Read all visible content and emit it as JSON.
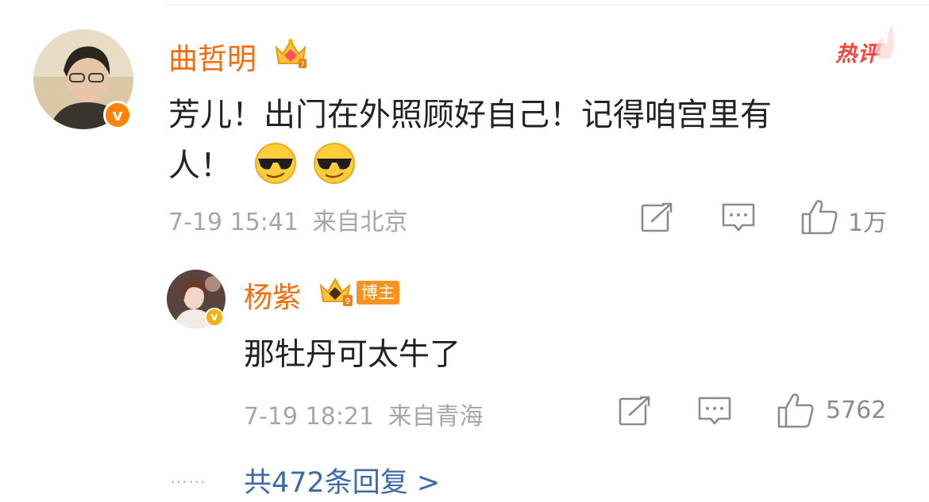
{
  "comment": {
    "username": "曲哲明",
    "badge": "热评",
    "content_line1": "芳儿！出门在外照顾好自己！记得咱宫里有",
    "content_line2": "人！",
    "emoji_icon": "sunglasses-emoji-icon",
    "time": "7-19 15:41",
    "location": "来自北京",
    "likes": "1万"
  },
  "reply": {
    "username": "杨紫",
    "tag": "博主",
    "content": "那牡丹可太牛了",
    "time": "7-19 18:21",
    "location": "来自青海",
    "likes": "5762"
  },
  "footer": {
    "dots": "……",
    "reply_link": "共472条回复 >"
  },
  "colors": {
    "username": "#f96b0a",
    "hot": "#ff3f3a",
    "link": "#3a6aad",
    "meta": "#a6a6a6",
    "verified_orange": "#ff8200",
    "verified_gold": "#f6b20c"
  }
}
